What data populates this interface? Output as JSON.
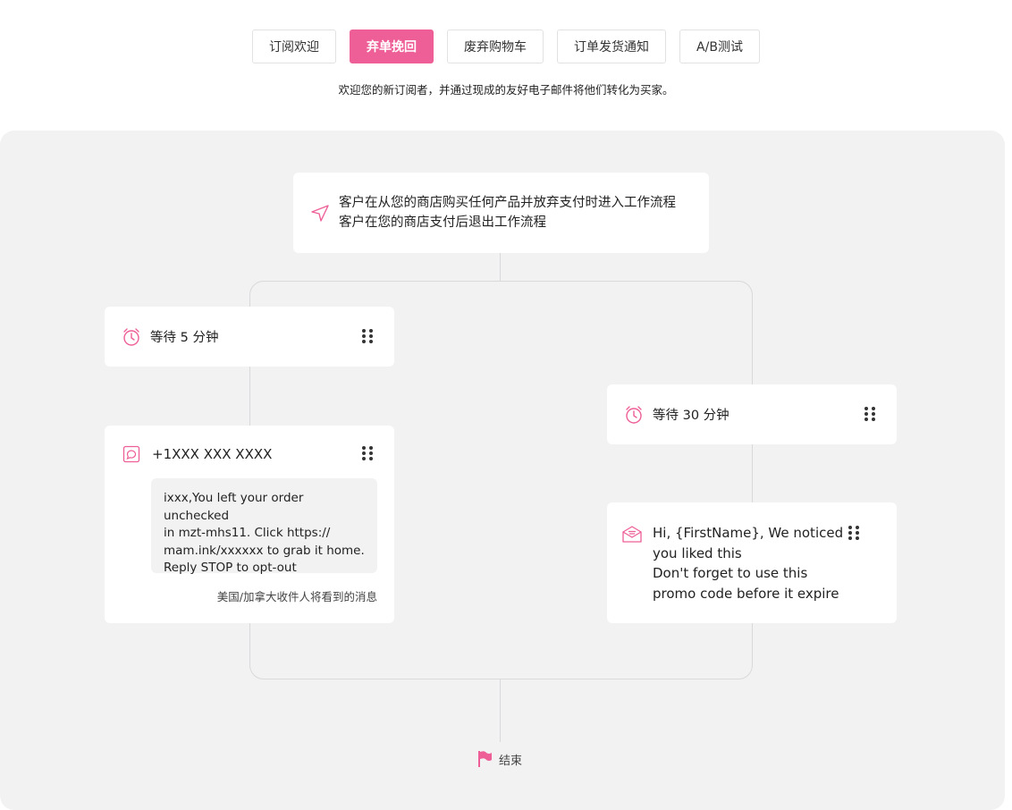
{
  "tabs": [
    {
      "label": "订阅欢迎",
      "active": false
    },
    {
      "label": "弃单挽回",
      "active": true
    },
    {
      "label": "废弃购物车",
      "active": false
    },
    {
      "label": "订单发货通知",
      "active": false
    },
    {
      "label": "A/B测试",
      "active": false
    }
  ],
  "subtitle": "欢迎您的新订阅者，并通过现成的友好电子邮件将他们转化为买家。",
  "trigger": {
    "icon": "send-icon",
    "line1": "客户在从您的商店购买任何产品并放弃支付时进入工作流程",
    "line2": "客户在您的商店支付后退出工作流程"
  },
  "left_branch": {
    "wait": {
      "icon": "alarm-clock-icon",
      "label": "等待 5 分钟"
    },
    "sms": {
      "icon": "sms-icon",
      "phone": "+1XXX XXX XXXX",
      "message_lines": [
        "ixxx,You left your order unchecked",
        "in mzt-mhs11. Click https://",
        "mam.ink/xxxxxx to grab it home.",
        "Reply STOP to opt-out"
      ],
      "note": "美国/加拿大收件人将看到的消息"
    }
  },
  "right_branch": {
    "wait": {
      "icon": "alarm-clock-icon",
      "label": "等待 30 分钟"
    },
    "email": {
      "icon": "email-icon",
      "lines": [
        "Hi, {FirstName}, We noticed",
        "you liked this",
        "Don't forget to use this",
        "promo code before it expire"
      ]
    }
  },
  "end": {
    "icon": "flag-icon",
    "label": "结束"
  },
  "colors": {
    "accent": "#ee5f97",
    "canvas": "#f2f2f3",
    "connector": "#d9d9db"
  }
}
